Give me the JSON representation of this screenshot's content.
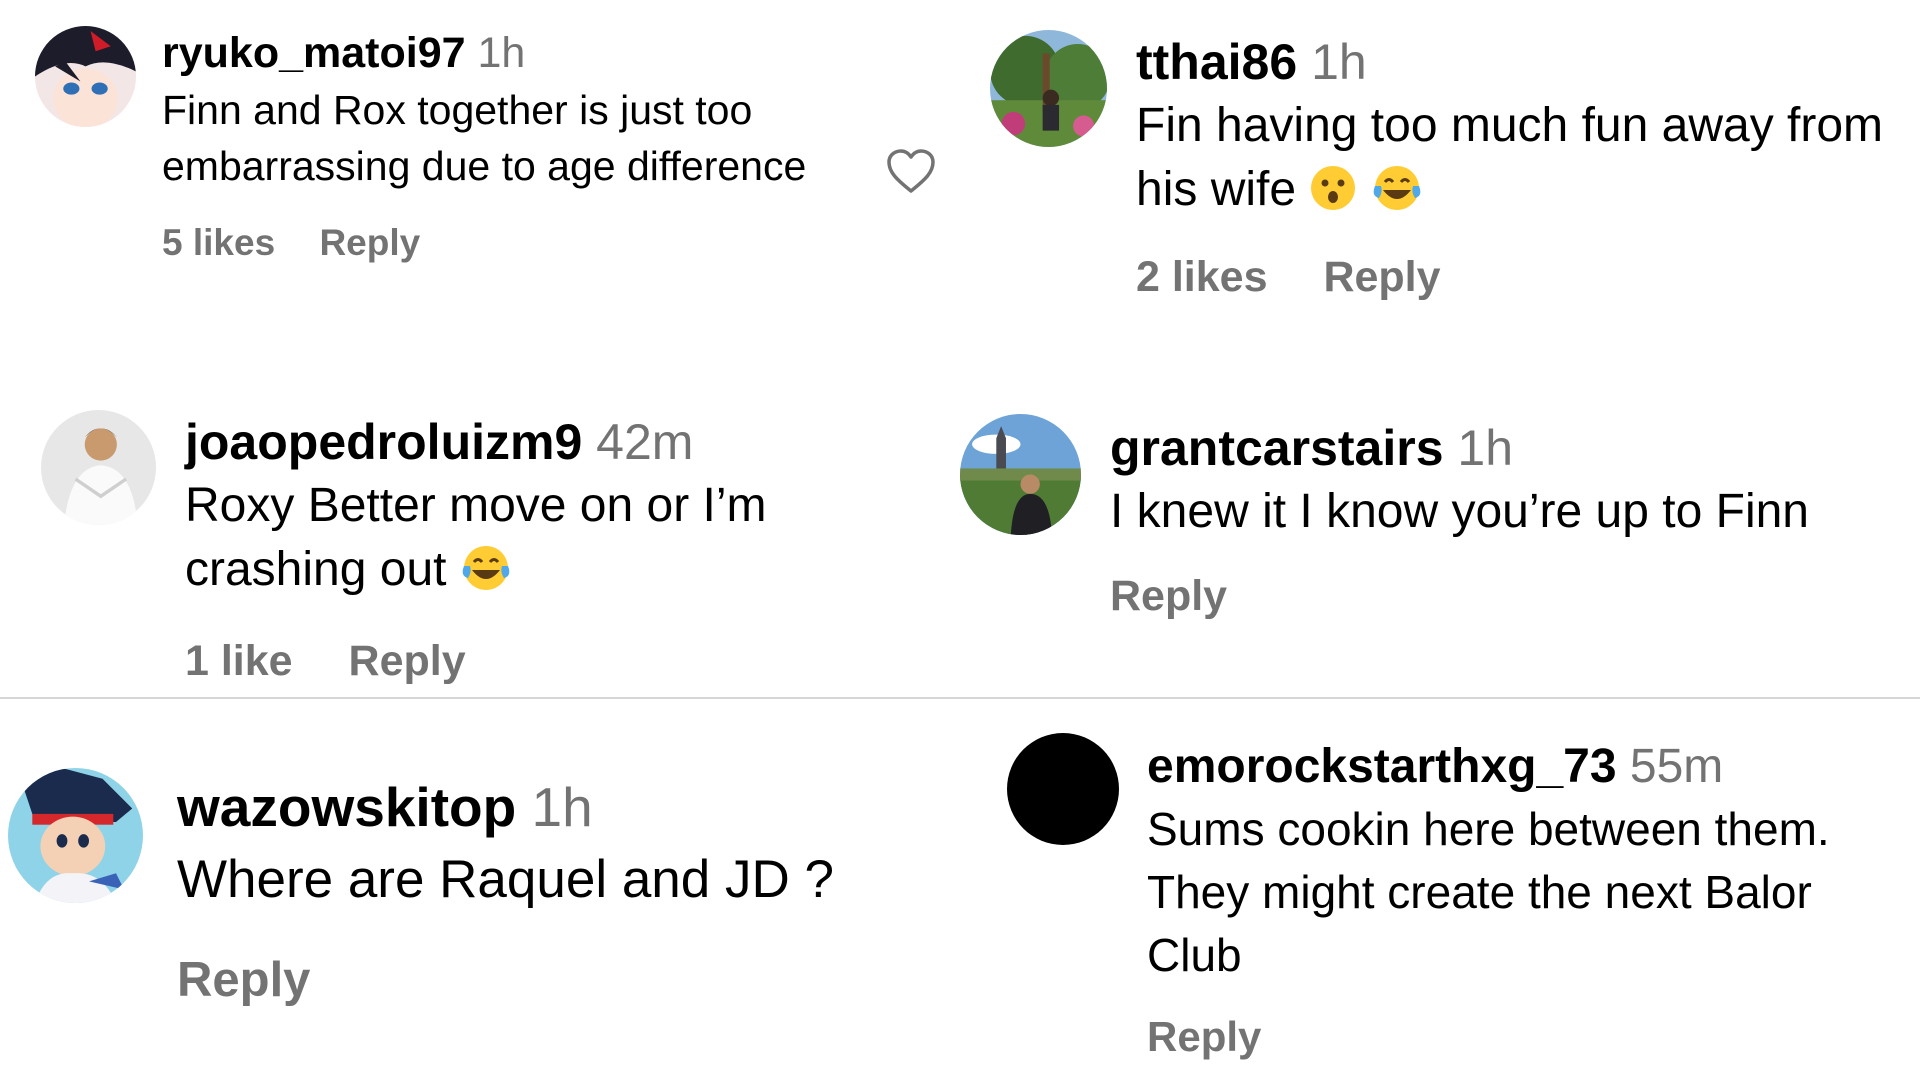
{
  "comments": [
    {
      "username": "ryuko_matoi97",
      "time": "1h",
      "text": "Finn and Rox together is just too embarrassing due to age difference",
      "likes": "5 likes",
      "reply": "Reply"
    },
    {
      "username": "tthai86",
      "time": "1h",
      "text": "Fin having too much fun away from his wife",
      "emoji": [
        "surprised-face",
        "tears-of-joy-face"
      ],
      "likes": "2 likes",
      "reply": "Reply"
    },
    {
      "username": "joaopedroluizm9",
      "time": "42m",
      "text": "Roxy Better move on or I’m crashing out",
      "emoji": [
        "tears-of-joy-face"
      ],
      "likes": "1 like",
      "reply": "Reply"
    },
    {
      "username": "grantcarstairs",
      "time": "1h",
      "text": "I knew it I know you’re up to Finn",
      "reply": "Reply"
    },
    {
      "username": "wazowskitop",
      "time": "1h",
      "text": "Where are Raquel and JD ?",
      "reply": "Reply"
    },
    {
      "username": "emorockstarthxg_73",
      "time": "55m",
      "text": "Sums cookin here between them. They might create the next Balor Club",
      "reply": "Reply"
    }
  ],
  "icons": {
    "like": "heart-outline-icon"
  },
  "colors": {
    "username": "#000000",
    "secondary_text": "#737373",
    "divider": "#d6d6d6",
    "background": "#ffffff"
  }
}
